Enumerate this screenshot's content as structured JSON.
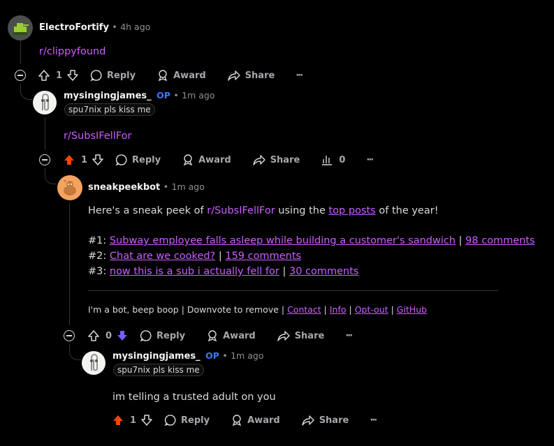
{
  "colors": {
    "background": "#000000",
    "link": "#cb5fff",
    "upvoted": "#ff4500",
    "downvoted": "#7a5cff",
    "op": "#3d7bf5"
  },
  "actions": {
    "reply": "Reply",
    "award": "Award",
    "share": "Share",
    "more": "···"
  },
  "c1": {
    "author": "ElectroFortify",
    "dot": "•",
    "time": "4h ago",
    "body": "r/clippyfound",
    "score": "1"
  },
  "c2": {
    "author": "mysingingjames_",
    "op": "OP",
    "dot": "•",
    "time": "1m ago",
    "flair": "spu7nix pls kiss me",
    "body": "r/SubsIFellFor",
    "score": "1",
    "insights": "0"
  },
  "c3": {
    "author": "sneakpeekbot",
    "dot": "•",
    "time": "1m ago",
    "intro_1": "Here's a sneak peek of ",
    "intro_sub": "r/SubsIFellFor",
    "intro_2": " using the ",
    "intro_link": "top posts",
    "intro_3": " of the year!",
    "posts": [
      {
        "num": "#1: ",
        "title": "Subway employee falls asleep while building a customer's sandwich",
        "sep": " | ",
        "comments": "98 comments"
      },
      {
        "num": "#2: ",
        "title": "Chat are we cooked?",
        "sep": " | ",
        "comments": "159 comments"
      },
      {
        "num": "#3: ",
        "title": "now this is a sub i actually fell for",
        "sep": " | ",
        "comments": "30 comments"
      }
    ],
    "footer_text": "I'm a bot, beep boop | Downvote to remove | ",
    "footer_sep": " | ",
    "footer_links": [
      "Contact",
      "Info",
      "Opt-out",
      "GitHub"
    ],
    "score": "0"
  },
  "c4": {
    "author": "mysingingjames_",
    "op": "OP",
    "dot": "•",
    "time": "1m ago",
    "flair": "spu7nix pls kiss me",
    "body": "im telling a trusted adult on you",
    "score": "1"
  }
}
